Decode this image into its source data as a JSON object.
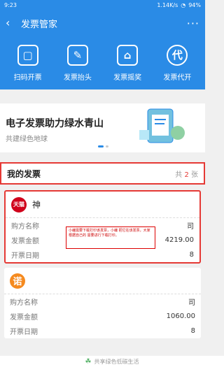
{
  "status": {
    "time": "9:23",
    "network": "1.14K/s",
    "battery": "94%"
  },
  "appbar": {
    "title": "发票管家",
    "more": "···"
  },
  "tools": [
    {
      "label": "扫码开票",
      "icon": "scan-icon"
    },
    {
      "label": "发票抬头",
      "icon": "edit-icon"
    },
    {
      "label": "发票摇奖",
      "icon": "gift-icon"
    },
    {
      "label": "发票代开",
      "icon": "proxy-icon",
      "glyph": "代"
    }
  ],
  "banner": {
    "title": "电子发票助力绿水青山",
    "subtitle": "共建绿色地球"
  },
  "section": {
    "title": "我的发票",
    "count_prefix": "共",
    "count_num": "2",
    "count_suffix": "张"
  },
  "invoices": [
    {
      "logo_text": "天猫",
      "merchant": "神",
      "buyer_label": "购方名称",
      "buyer_value": "司",
      "amount_label": "发票金额",
      "amount_value": "4219.00",
      "date_label": "开票日期",
      "date_value": "8"
    },
    {
      "logo_text": "诺",
      "merchant": "",
      "buyer_label": "购方名称",
      "buyer_value": "司",
      "amount_label": "发票金额",
      "amount_value": "1060.00",
      "date_label": "开票日期",
      "date_value": "8"
    }
  ],
  "note_text": "小编需要下载打印该发票，小编 把它在该发票，大家根据自己的 需要进行下载打印。",
  "bottom": {
    "text": "共享绿色低碳生活"
  },
  "colors": {
    "primary": "#2a8be6",
    "highlight": "#e53935"
  }
}
